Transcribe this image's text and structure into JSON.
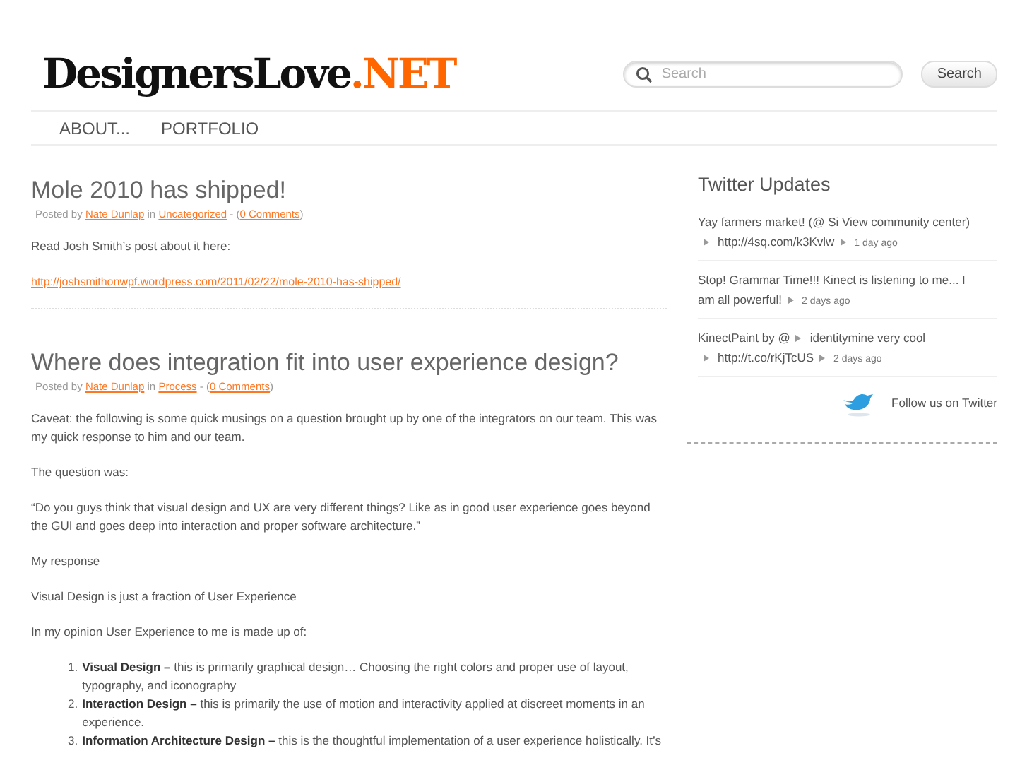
{
  "logo": {
    "name": "DesignersLove",
    "suffix": ".NET"
  },
  "search": {
    "placeholder": "Search",
    "button": "Search"
  },
  "nav": [
    {
      "label": "ABOUT..."
    },
    {
      "label": "PORTFOLIO"
    }
  ],
  "posts": [
    {
      "title": "Mole 2010 has shipped!",
      "meta": {
        "prefix": "Posted by",
        "author": "Nate Dunlap",
        "in": "in",
        "category": "Uncategorized",
        "sep": "- (",
        "comments": "0 Comments",
        "end": ")"
      },
      "body": [
        {
          "kind": "para",
          "text": "Read Josh Smith’s post about it here:"
        },
        {
          "kind": "link",
          "text": "http://joshsmithonwpf.wordpress.com/2011/02/22/mole-2010-has-shipped/"
        }
      ]
    },
    {
      "title": "Where does integration fit into user experience design?",
      "meta": {
        "prefix": "Posted by",
        "author": "Nate Dunlap",
        "in": "in",
        "category": "Process",
        "sep": "- (",
        "comments": "0 Comments",
        "end": ")"
      },
      "body": [
        {
          "kind": "para",
          "text": "Caveat: the following is some quick musings on a question brought up by one of the integrators on our team. This was my quick response to him and our team."
        },
        {
          "kind": "para",
          "text": "The question was:"
        },
        {
          "kind": "para",
          "text": "“Do you guys think that visual design and UX are very different things? Like as in good user experience goes beyond the GUI and goes deep into interaction and proper software architecture.”"
        },
        {
          "kind": "para",
          "text": "My response"
        },
        {
          "kind": "para",
          "text": "Visual Design is just a fraction of User Experience"
        },
        {
          "kind": "para",
          "text": "In my opinion User Experience to me is made up of:"
        },
        {
          "kind": "list",
          "items": [
            {
              "marker": "1.",
              "text": "**Visual Design –** this is primarily graphical design… Choosing the right colors and proper use of layout, typography, and iconography"
            },
            {
              "marker": "2.",
              "text": "**Interaction Design –** this is primarily the use of motion and interactivity applied at discreet moments in an experience."
            },
            {
              "marker": "3.",
              "text": "**Information Architecture Design –** this is the thoughtful implementation of a user experience holistically. It’s"
            }
          ]
        }
      ]
    }
  ],
  "twitter": {
    "title": "Twitter Updates",
    "tweets": [
      {
        "segments": [
          {
            "kind": "text",
            "text": "Yay farmers market! (@ Si View community center)"
          },
          {
            "kind": "link",
            "text": "http://4sq.com/k3Kvlw"
          },
          {
            "kind": "time",
            "text": "1 day ago"
          }
        ]
      },
      {
        "segments": [
          {
            "kind": "text",
            "text": "Stop! Grammar Time!!! Kinect is listening to me... I"
          },
          {
            "kind": "cont",
            "text": "am all powerful!"
          },
          {
            "kind": "time",
            "text": "2 days ago"
          }
        ]
      },
      {
        "segments": [
          {
            "kind": "text",
            "text": "KinectPaint by @"
          },
          {
            "kind": "mention",
            "text": "identitymine very cool"
          },
          {
            "kind": "link",
            "text": "http://t.co/rKjTcUS"
          },
          {
            "kind": "time",
            "text": "2 days ago"
          }
        ]
      }
    ],
    "follow": "Follow us on Twitter"
  }
}
